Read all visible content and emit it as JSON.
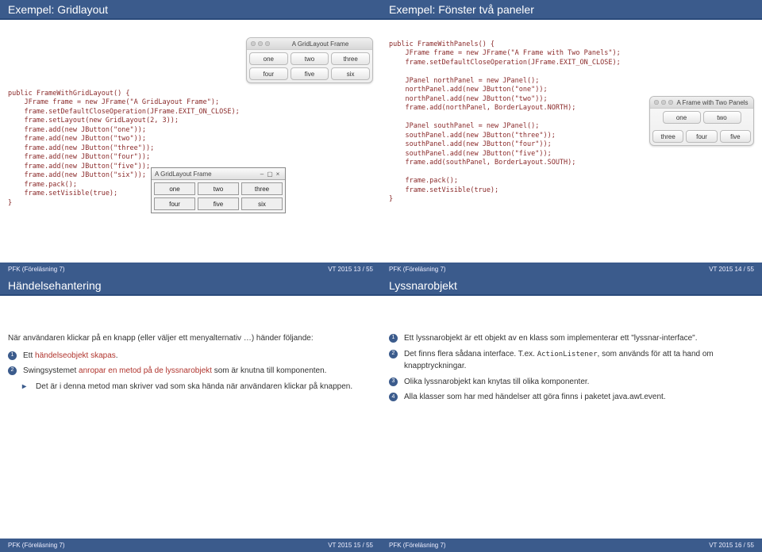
{
  "slides": {
    "s1": {
      "title": "Exempel: Gridlayout",
      "code": "public FrameWithGridLayout() {\n    JFrame frame = new JFrame(\"A GridLayout Frame\");\n    frame.setDefaultCloseOperation(JFrame.EXIT_ON_CLOSE);\n    frame.setLayout(new GridLayout(2, 3));\n    frame.add(new JButton(\"one\"));\n    frame.add(new JButton(\"two\"));\n    frame.add(new JButton(\"three\"));\n    frame.add(new JButton(\"four\"));\n    frame.add(new JButton(\"five\"));\n    frame.add(new JButton(\"six\"));\n    frame.pack();\n    frame.setVisible(true);\n}",
      "mac_title": "A GridLayout Frame",
      "mac_rows": [
        [
          "one",
          "two",
          "three"
        ],
        [
          "four",
          "five",
          "six"
        ]
      ],
      "win_title": "A GridLayout Frame",
      "win_rows": [
        [
          "one",
          "two",
          "three"
        ],
        [
          "four",
          "five",
          "six"
        ]
      ],
      "footer_left": "PFK (Föreläsning 7)",
      "footer_center": "",
      "footer_right": "VT 2015   13 / 55"
    },
    "s2": {
      "title": "Exempel: Fönster två paneler",
      "code": "public FrameWithPanels() {\n    JFrame frame = new JFrame(\"A Frame with Two Panels\");\n    frame.setDefaultCloseOperation(JFrame.EXIT_ON_CLOSE);\n\n    JPanel northPanel = new JPanel();\n    northPanel.add(new JButton(\"one\"));\n    northPanel.add(new JButton(\"two\"));\n    frame.add(northPanel, BorderLayout.NORTH);\n\n    JPanel southPanel = new JPanel();\n    southPanel.add(new JButton(\"three\"));\n    southPanel.add(new JButton(\"four\"));\n    southPanel.add(new JButton(\"five\"));\n    frame.add(southPanel, BorderLayout.SOUTH);\n\n    frame.pack();\n    frame.setVisible(true);\n}",
      "mac_title": "A Frame with Two Panels",
      "mac_north": [
        "one",
        "two"
      ],
      "mac_south": [
        "three",
        "four",
        "five"
      ],
      "footer_left": "PFK (Föreläsning 7)",
      "footer_right": "VT 2015   14 / 55"
    },
    "s3": {
      "title": "Händelsehantering",
      "lead": "När användaren klickar på en knapp (eller väljer ett menyalternativ …) händer följande:",
      "items": [
        {
          "n": "1",
          "prefix": "Ett ",
          "hl": "händelseobjekt skapas",
          "suffix": "."
        },
        {
          "n": "2",
          "prefix": "Swingsystemet ",
          "hl": "anropar en metod på de lyssnarobjekt",
          "suffix": " som är knutna till komponenten."
        }
      ],
      "sub": "Det är i denna metod man skriver vad som ska hända när användaren klickar på knappen.",
      "footer_left": "PFK (Föreläsning 7)",
      "footer_right": "VT 2015   15 / 55"
    },
    "s4": {
      "title": "Lyssnarobjekt",
      "items": [
        {
          "n": "1",
          "text": "Ett lyssnarobjekt är ett objekt av en klass som implementerar ett \"lyssnar-interface\"."
        },
        {
          "n": "2",
          "text_pre": "Det finns flera sådana interface. T.ex. ",
          "mono": "ActionListener",
          "text_post": ", som används för att ta hand om knapptryckningar."
        },
        {
          "n": "3",
          "text": "Olika lyssnarobjekt kan knytas till olika komponenter."
        },
        {
          "n": "4",
          "text": "Alla klasser som har med händelser att göra finns i paketet java.awt.event."
        }
      ],
      "footer_left": "PFK (Föreläsning 7)",
      "footer_right": "VT 2015   16 / 55"
    }
  }
}
